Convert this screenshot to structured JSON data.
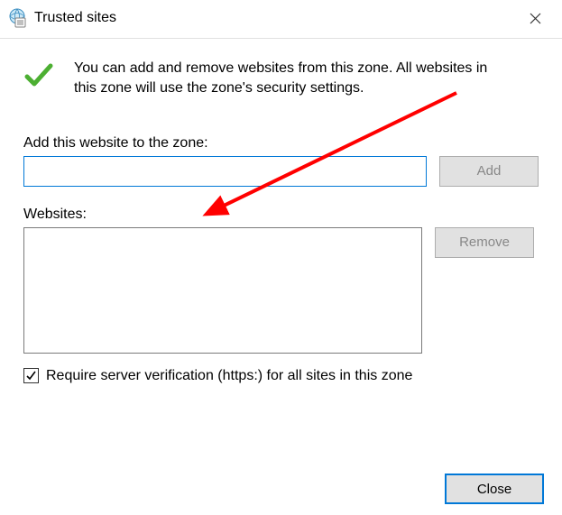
{
  "titlebar": {
    "title": "Trusted sites"
  },
  "info": {
    "text": "You can add and remove websites from this zone. All websites in this zone will use the zone's security settings."
  },
  "add": {
    "label": "Add this website to the zone:",
    "value": "",
    "button": "Add"
  },
  "websites": {
    "label": "Websites:",
    "items": [],
    "remove_button": "Remove"
  },
  "require_https": {
    "checked": true,
    "label": "Require server verification (https:) for all sites in this zone"
  },
  "footer": {
    "close": "Close"
  },
  "annotation": {
    "arrow_color": "#ff0000"
  }
}
